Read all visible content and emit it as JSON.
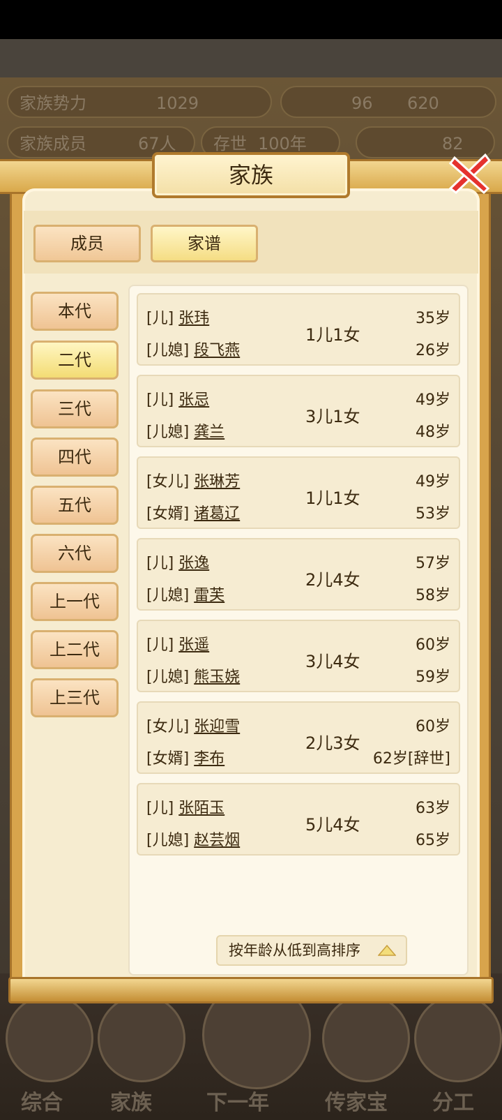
{
  "hud": {
    "power_label": "家族势力",
    "power_value": "1029",
    "stat_1": "96",
    "stat_2": "620",
    "members_label": "家族成员",
    "members_value": "67人",
    "alive_label": "存世",
    "alive_value": "100年",
    "gold_value": "82",
    "bottom_nav": [
      "综合",
      "家族",
      "下一年",
      "传家宝",
      "分工"
    ]
  },
  "modal": {
    "title": "家族",
    "tabs": [
      {
        "label": "成员",
        "active": false
      },
      {
        "label": "家谱",
        "active": true
      }
    ],
    "generations": [
      {
        "label": "本代",
        "active": false
      },
      {
        "label": "二代",
        "active": true
      },
      {
        "label": "三代",
        "active": false
      },
      {
        "label": "四代",
        "active": false
      },
      {
        "label": "五代",
        "active": false
      },
      {
        "label": "六代",
        "active": false
      },
      {
        "label": "上一代",
        "active": false
      },
      {
        "label": "上二代",
        "active": false
      },
      {
        "label": "上三代",
        "active": false
      }
    ],
    "couples": [
      {
        "p1_tag": "[儿]",
        "p1_name": "张玮",
        "p1_age": "35岁",
        "p2_tag": "[儿媳]",
        "p2_name": "段飞燕",
        "p2_age": "26岁",
        "children": "1儿1女"
      },
      {
        "p1_tag": "[儿]",
        "p1_name": "张忌",
        "p1_age": "49岁",
        "p2_tag": "[儿媳]",
        "p2_name": "龚兰",
        "p2_age": "48岁",
        "children": "3儿1女"
      },
      {
        "p1_tag": "[女儿]",
        "p1_name": "张琳芳",
        "p1_age": "49岁",
        "p2_tag": "[女婿]",
        "p2_name": "诸葛辽",
        "p2_age": "53岁",
        "children": "1儿1女"
      },
      {
        "p1_tag": "[儿]",
        "p1_name": "张逸",
        "p1_age": "57岁",
        "p2_tag": "[儿媳]",
        "p2_name": "雷芙",
        "p2_age": "58岁",
        "children": "2儿4女"
      },
      {
        "p1_tag": "[儿]",
        "p1_name": "张遥",
        "p1_age": "60岁",
        "p2_tag": "[儿媳]",
        "p2_name": "熊玉娆",
        "p2_age": "59岁",
        "children": "3儿4女"
      },
      {
        "p1_tag": "[女儿]",
        "p1_name": "张迎雪",
        "p1_age": "60岁",
        "p2_tag": "[女婿]",
        "p2_name": "李布",
        "p2_age": "62岁[辞世]",
        "children": "2儿3女"
      },
      {
        "p1_tag": "[儿]",
        "p1_name": "张陌玉",
        "p1_age": "63岁",
        "p2_tag": "[儿媳]",
        "p2_name": "赵芸烟",
        "p2_age": "65岁",
        "children": "5儿4女"
      }
    ],
    "sort_label": "按年龄从低到高排序"
  }
}
